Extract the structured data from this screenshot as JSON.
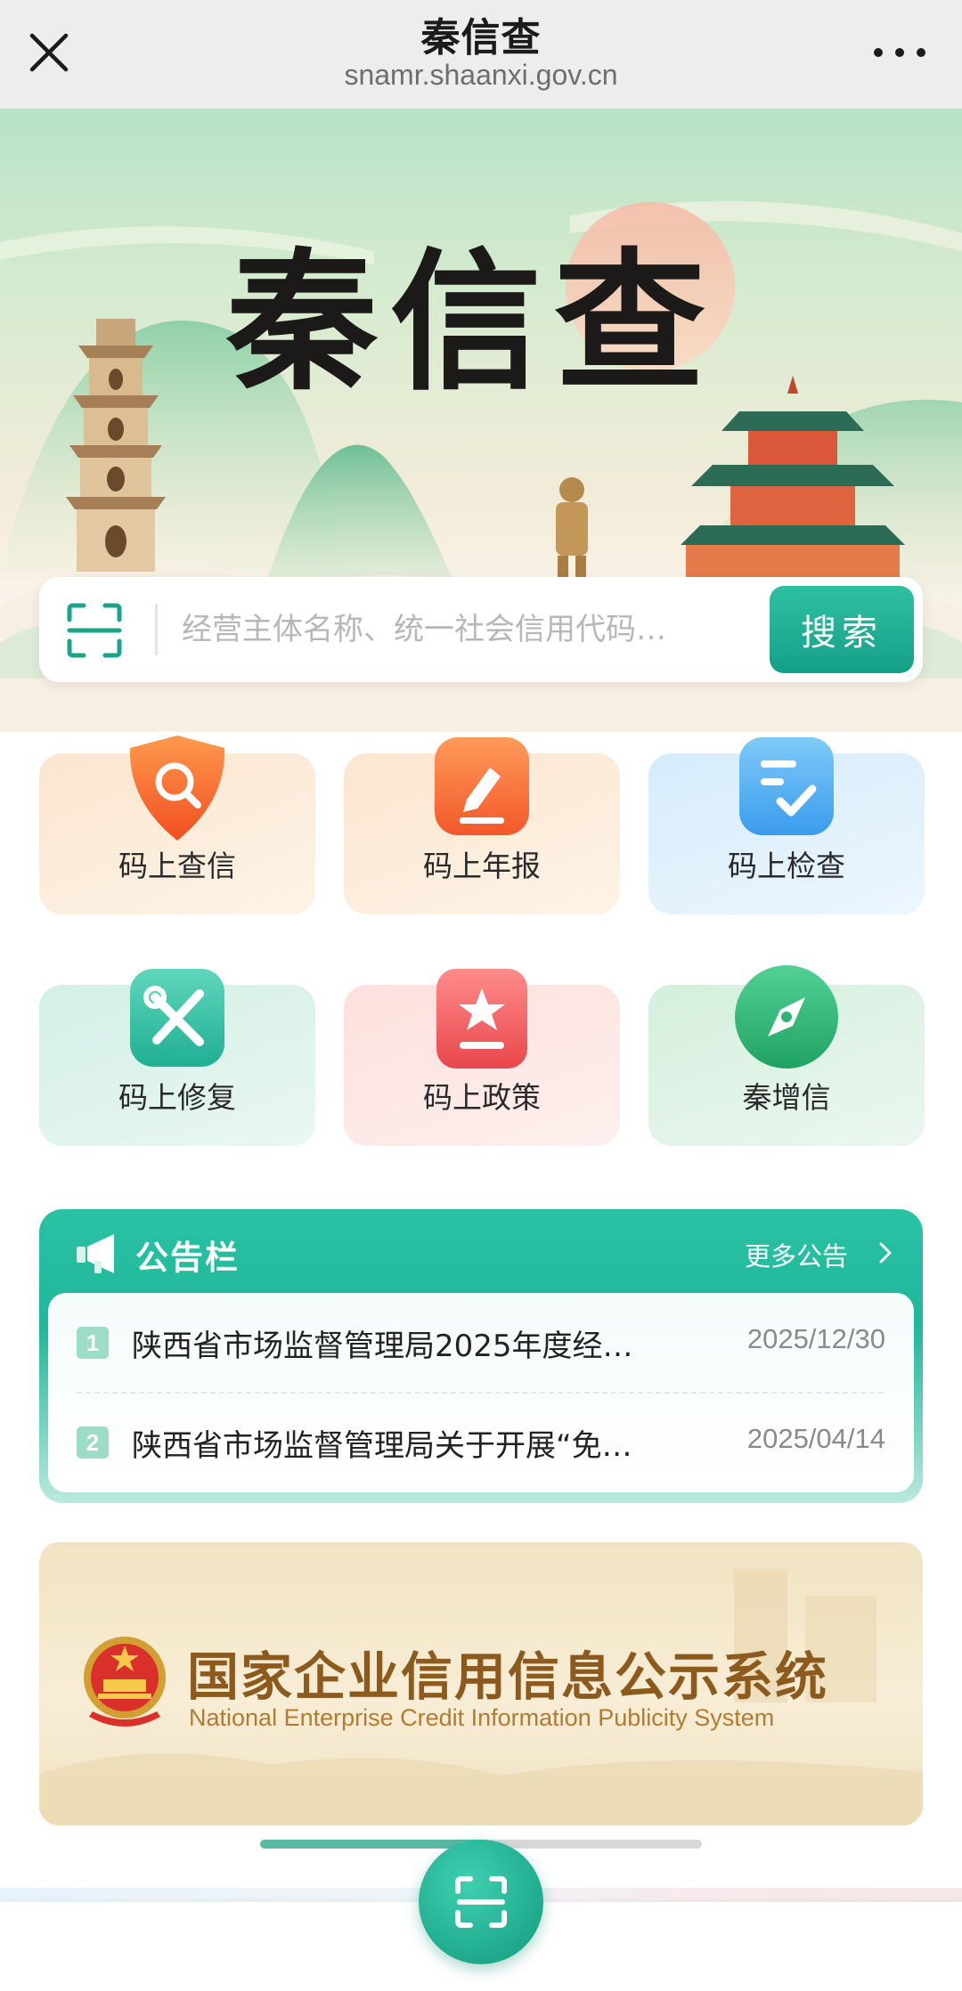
{
  "window": {
    "title": "秦信查",
    "domain": "snamr.shaanxi.gov.cn",
    "close_icon": "close-icon",
    "more_icon": "more-icon"
  },
  "hero": {
    "title": "秦信查"
  },
  "search": {
    "placeholder": "经营主体名称、统一社会信用代码…",
    "button_label": "搜索",
    "scan_icon": "scan-icon"
  },
  "tiles": [
    {
      "label": "码上查信",
      "icon": "search-shield-icon",
      "color": "#f46a2b"
    },
    {
      "label": "码上年报",
      "icon": "edit-report-icon",
      "color": "#f26a36"
    },
    {
      "label": "码上检查",
      "icon": "checklist-icon",
      "color": "#3aa6ef"
    },
    {
      "label": "码上修复",
      "icon": "tools-icon",
      "color": "#26bfa0"
    },
    {
      "label": "码上政策",
      "icon": "policy-star-icon",
      "color": "#ec5a5e"
    },
    {
      "label": "秦增信",
      "icon": "compass-icon",
      "color": "#29b574"
    }
  ],
  "notices": {
    "title": "公告栏",
    "more_label": "更多公告",
    "items": [
      {
        "num": "1",
        "text": "陕西省市场监督管理局2025年度经…",
        "date": "2025/12/30"
      },
      {
        "num": "2",
        "text": "陕西省市场监督管理局关于开展“免…",
        "date": "2025/04/14"
      }
    ]
  },
  "banner": {
    "title_cn": "国家企业信用信息公示系统",
    "title_en": "National Enterprise Credit Information Publicity System",
    "emblem_icon": "national-emblem-icon"
  },
  "scroll": {
    "position_fraction": 0.5
  },
  "fab": {
    "icon": "scan-icon"
  },
  "colors": {
    "accent": "#1fa88c",
    "notice_bg": "#23b99b"
  }
}
